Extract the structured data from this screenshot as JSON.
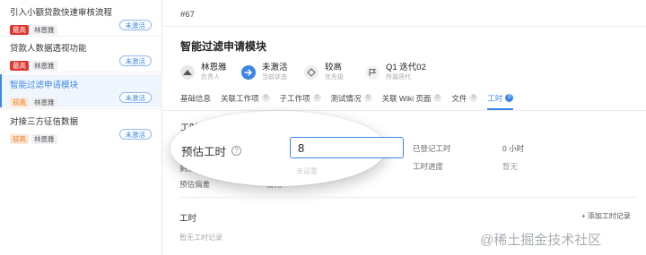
{
  "list": {
    "items": [
      {
        "title": "引入小额贷款快速审核流程",
        "priority": "最高",
        "assignee": "林恩雅",
        "status": "未激活"
      },
      {
        "title": "贷款人数据透视功能",
        "priority": "最高",
        "assignee": "林恩雅",
        "status": "未激活"
      },
      {
        "title": "智能过滤申请模块",
        "priority": "较高",
        "assignee": "林恩雅",
        "status": "未激活"
      },
      {
        "title": "对接三方征信数据",
        "priority": "较高",
        "assignee": "林恩雅",
        "status": "未激活"
      }
    ]
  },
  "detail": {
    "number": "#67",
    "title": "智能过滤申请模块",
    "props": {
      "owner": {
        "value": "林恩雅",
        "caption": "负责人"
      },
      "state": {
        "value": "未激活",
        "caption": "当前状态"
      },
      "priority": {
        "value": "较高",
        "caption": "优先级"
      },
      "iteration": {
        "value": "Q1 迭代02",
        "caption": "所属迭代"
      }
    },
    "tabs": [
      {
        "label": "基础信息",
        "count": ""
      },
      {
        "label": "关联工作项",
        "count": "0"
      },
      {
        "label": "子工作项",
        "count": "0"
      },
      {
        "label": "测试情况",
        "count": "0"
      },
      {
        "label": "关联 Wiki 页面",
        "count": "0"
      },
      {
        "label": "文件",
        "count": "0"
      },
      {
        "label": "工时",
        "count": "0"
      }
    ],
    "worklog": {
      "section_title": "工时信息",
      "estimate_label": "预估工时",
      "estimate_value": "8",
      "remaining_label": "剩余工时",
      "recorded_label": "已登记工时",
      "recorded_value": "0 小时",
      "progress_label": "工时进度",
      "progress_value": "暂无",
      "deviation_label": "预估偏差",
      "deviation_value": "暂无",
      "ghost_value": "未设置"
    },
    "logs": {
      "section_title": "工时",
      "add_label": "+ 添加工时记录",
      "empty_text": "暂无工时记录"
    }
  },
  "watermark": "@稀土掘金技术社区",
  "colors": {
    "accent": "#3b86e8",
    "priority_high": "#e0362f",
    "priority_mid": "#e97a22"
  }
}
